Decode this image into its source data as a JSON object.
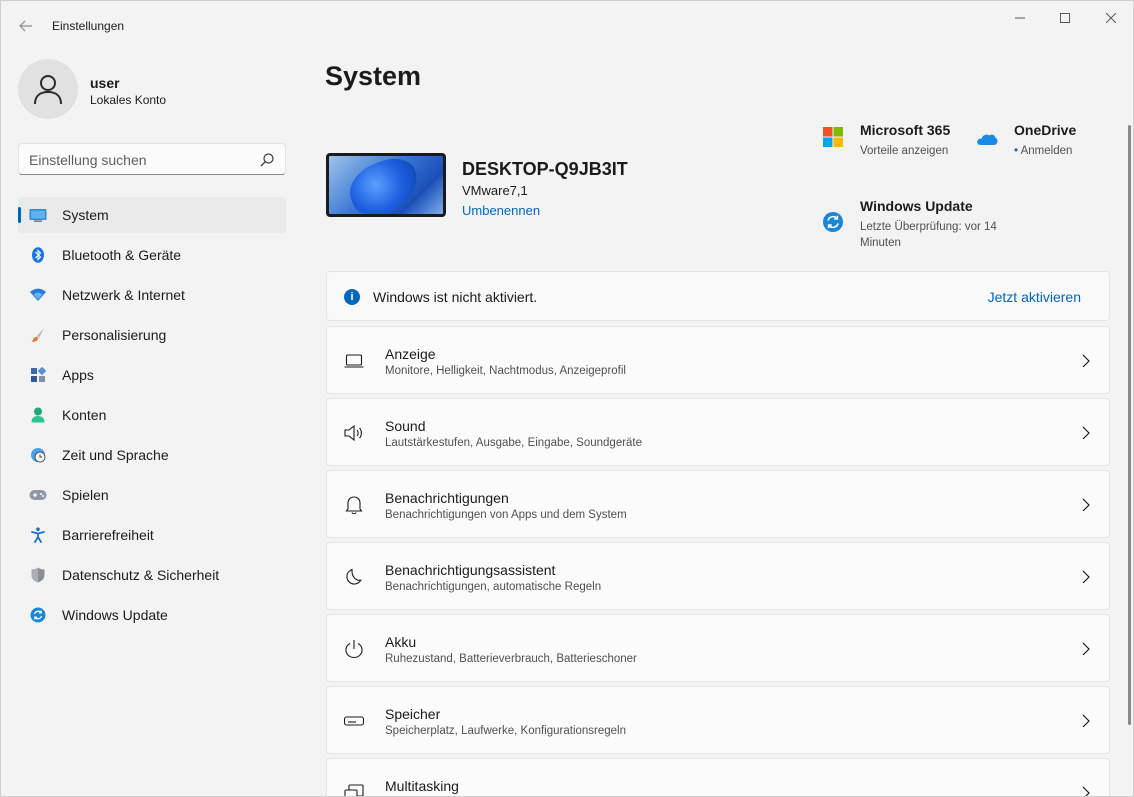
{
  "window": {
    "app_title": "Einstellungen"
  },
  "user": {
    "name": "user",
    "account_type": "Lokales Konto"
  },
  "search": {
    "placeholder": "Einstellung suchen"
  },
  "nav": {
    "items": [
      {
        "label": "System",
        "icon": "monitor-icon",
        "active": true
      },
      {
        "label": "Bluetooth & Geräte",
        "icon": "bluetooth-icon"
      },
      {
        "label": "Netzwerk & Internet",
        "icon": "wifi-icon"
      },
      {
        "label": "Personalisierung",
        "icon": "brush-icon"
      },
      {
        "label": "Apps",
        "icon": "apps-icon"
      },
      {
        "label": "Konten",
        "icon": "person-icon"
      },
      {
        "label": "Zeit und Sprache",
        "icon": "globe-clock-icon"
      },
      {
        "label": "Spielen",
        "icon": "gamepad-icon"
      },
      {
        "label": "Barrierefreiheit",
        "icon": "accessibility-icon"
      },
      {
        "label": "Datenschutz & Sicherheit",
        "icon": "shield-icon"
      },
      {
        "label": "Windows Update",
        "icon": "update-icon"
      }
    ]
  },
  "main": {
    "page_title": "System",
    "device": {
      "name": "DESKTOP-Q9JB3IT",
      "model": "VMware7,1",
      "rename_label": "Umbenennen"
    },
    "tiles": {
      "m365": {
        "title": "Microsoft 365",
        "subtitle": "Vorteile anzeigen"
      },
      "onedrive": {
        "title": "OneDrive",
        "subtitle": "Anmelden"
      },
      "update": {
        "title": "Windows Update",
        "subtitle_line1": "Letzte Überprüfung: vor 14",
        "subtitle_line2": "Minuten"
      }
    },
    "activation": {
      "message": "Windows ist nicht aktiviert.",
      "action": "Jetzt aktivieren"
    },
    "settings": [
      {
        "title": "Anzeige",
        "subtitle": "Monitore, Helligkeit, Nachtmodus, Anzeigeprofil",
        "icon": "display-icon"
      },
      {
        "title": "Sound",
        "subtitle": "Lautstärkestufen, Ausgabe, Eingabe, Soundgeräte",
        "icon": "speaker-icon"
      },
      {
        "title": "Benachrichtigungen",
        "subtitle": "Benachrichtigungen von Apps und dem System",
        "icon": "bell-icon"
      },
      {
        "title": "Benachrichtigungsassistent",
        "subtitle": "Benachrichtigungen, automatische Regeln",
        "icon": "moon-icon"
      },
      {
        "title": "Akku",
        "subtitle": "Ruhezustand, Batterieverbrauch, Batterieschoner",
        "icon": "power-icon"
      },
      {
        "title": "Speicher",
        "subtitle": "Speicherplatz, Laufwerke, Konfigurationsregeln",
        "icon": "drive-icon"
      },
      {
        "title": "Multitasking",
        "subtitle": "",
        "icon": "multitasking-icon"
      }
    ]
  }
}
